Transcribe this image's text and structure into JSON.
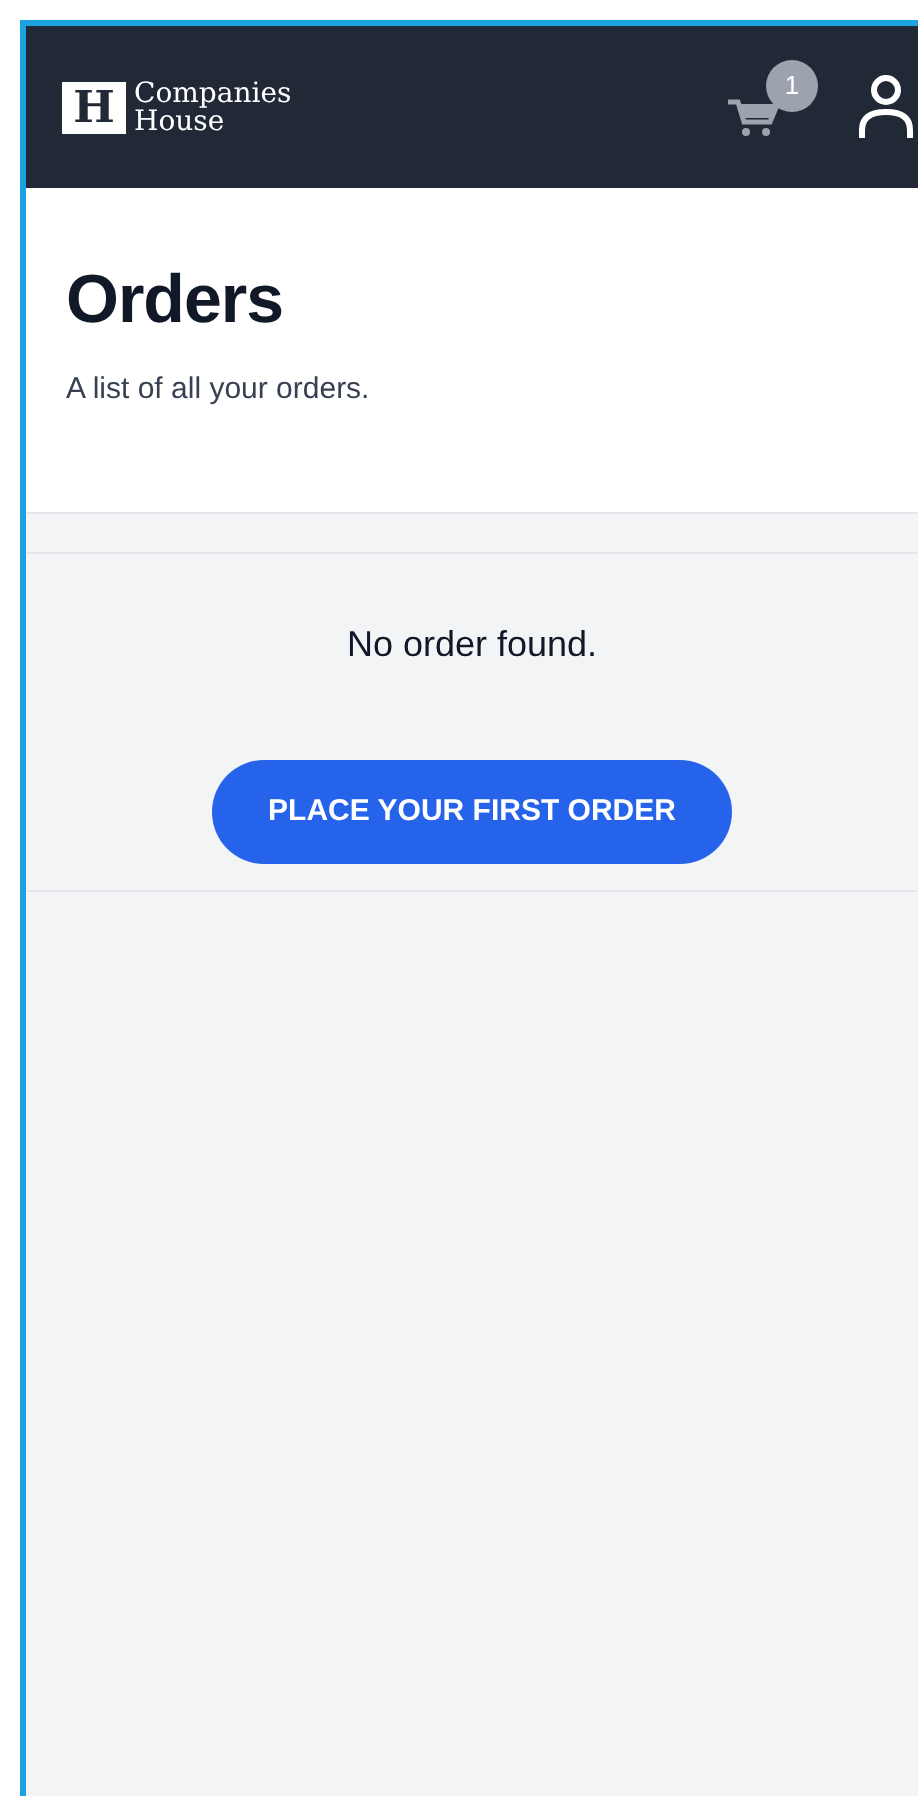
{
  "header": {
    "logo_mark": "H",
    "brand_lines": [
      "Companies",
      "House"
    ],
    "cart_count": "1"
  },
  "page": {
    "title": "Orders",
    "subtitle": "A list of all your orders."
  },
  "empty_state": {
    "message": "No order found.",
    "button": "PLACE YOUR FIRST ORDER"
  }
}
